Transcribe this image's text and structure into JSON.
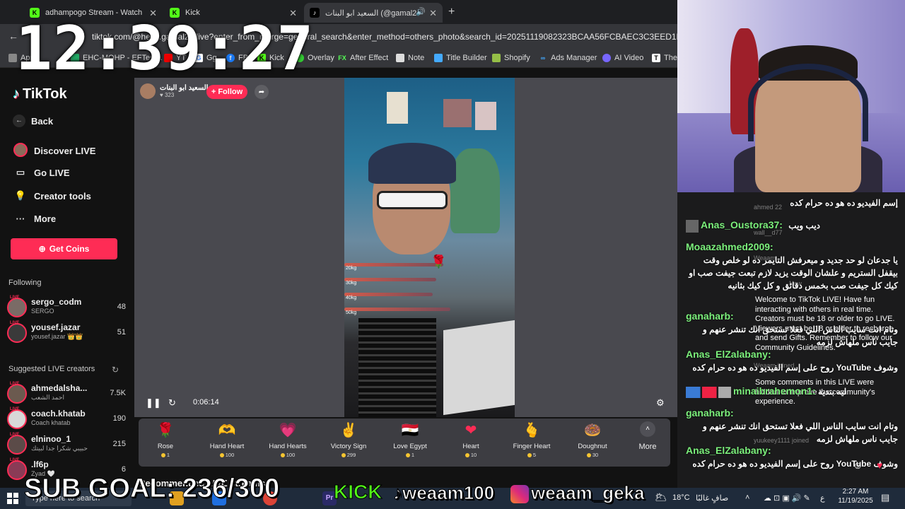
{
  "browser": {
    "tabs": [
      {
        "title": "adhampogo Stream - Watch Liv",
        "icon": "kick-icon",
        "active": false
      },
      {
        "title": "Kick",
        "icon": "kick-icon",
        "active": false
      },
      {
        "title": "السعيد ابو البنات (@gamal24",
        "icon": "tiktok-icon",
        "active": true
      }
    ],
    "url": "tiktok.com/@helio.gamal24/live?enter_from_merge=general_search&enter_method=others_photo&search_id=20251119082323BCAA56FCBAEC3C3EED1E&search",
    "bookmarks": [
      "Apps",
      "EHC-MOHP - EFTest...",
      "YT",
      "Gg",
      "FB",
      "Kick",
      "Overlay",
      "After Effect",
      "Note",
      "Title Builder",
      "Shopify",
      "Ads Manager",
      "AI Video",
      "The"
    ]
  },
  "tiktok": {
    "logo": "TikTok",
    "nav": [
      {
        "label": "Back",
        "icon": "arrow-left-icon"
      },
      {
        "label": "Discover LIVE",
        "icon": "avatar-icon"
      },
      {
        "label": "Go LIVE",
        "icon": "camera-icon"
      },
      {
        "label": "Creator tools",
        "icon": "lightbulb-icon"
      },
      {
        "label": "More",
        "icon": "ellipsis-icon"
      }
    ],
    "get_coins": "Get Coins",
    "following_title": "Following",
    "following": [
      {
        "name": "sergo_codm",
        "sub": "SERGO",
        "count": "48"
      },
      {
        "name": "yousef.jazar",
        "sub": "yousef.jazar 👑👑",
        "count": "51"
      }
    ],
    "suggested_title": "Suggested LIVE creators",
    "suggested": [
      {
        "name": "ahmedalsha...",
        "sub": "احمد الشعب",
        "count": "7.5K"
      },
      {
        "name": "coach.khatab",
        "sub": "Coach khatab",
        "count": "190"
      },
      {
        "name": "elninoo_1",
        "sub": "حبيبي شكرا جدا لبيتك",
        "count": "215"
      },
      {
        "name": ".lf6p",
        "sub": "Zyad 🤍",
        "count": "6"
      }
    ],
    "host": {
      "name": "السعيد ابو البنات",
      "viewers": "323"
    },
    "follow_label": "+ Follow",
    "video_time": "0:06:14",
    "gift_scale": [
      "20kg",
      "30kg",
      "40kg",
      "50kg"
    ],
    "gifts": [
      {
        "name": "Rose",
        "price": "1",
        "icon": "🌹"
      },
      {
        "name": "Hand Heart",
        "price": "100",
        "icon": "🫶"
      },
      {
        "name": "Hand Hearts",
        "price": "100",
        "icon": "💗"
      },
      {
        "name": "Victory Sign",
        "price": "299",
        "icon": "✌"
      },
      {
        "name": "Love Egypt",
        "price": "1",
        "icon": "🇪🇬"
      },
      {
        "name": "Heart",
        "price": "10",
        "icon": "❤"
      },
      {
        "name": "Finger Heart",
        "price": "5",
        "icon": "🫰"
      },
      {
        "name": "Doughnut",
        "price": "30",
        "icon": "🍩"
      }
    ],
    "more_label": "More",
    "recommended": "Recommended LIVE streams"
  },
  "chat": {
    "tiktok_notices": [
      "Welcome to TikTok LIVE! Have fun interacting with others in real time. Creators must be 18 or older to go LIVE. Viewers must be 18 or older to recharge and send Gifts. Remember to follow our Community Guidelines.",
      "Some comments in this LIVE were hidden to improve the community's experience."
    ],
    "tiktok_bg": [
      "ahmed 22",
      "wall__d77",
      "Weaam",
      "New",
      "Weaam joined",
      "yuukeey1111 joined"
    ],
    "messages": [
      {
        "user": "",
        "text": "إسم الفيديو ده هو ده حرام كده"
      },
      {
        "user": "Anas_Oustora37:",
        "text": "ديب ويب"
      },
      {
        "user": "Moaazahmed2009:",
        "text": "يا جدعان لو حد جديد و ميعرفش التايمر ده لو خلص وقت بيقفل الستريم و علشان الوقت يزيد لازم تبعت جيفت صب او كيك كل جيفت صب بخمس دقائق و كل كيك بثانيه"
      },
      {
        "user": "ganaharb:",
        "text": "وتام انت سايب الناس اللي فعلا تستحق انك تنشر عنهم و جايب ناس ملهاش لزمه"
      },
      {
        "user": "Anas_ElZalabany:",
        "text": "وشوف YouTube روح على إسم الفيديو ده هو ده حرام كده"
      },
      {
        "user": "minaibrahemon1:",
        "text": "ليه بتديه"
      },
      {
        "user": "ganaharb:",
        "text": "وتام انت سايب الناس اللي فعلا تستحق انك تنشر عنهم و جايب ناس ملهاش لزمه"
      },
      {
        "user": "Anas_ElZalabany:",
        "text": "وشوف YouTube روح على إسم الفيديو ده هو ده حرام كده"
      }
    ]
  },
  "overlay": {
    "clock": "12:39:27",
    "sub_goal": "SUB GOAL: 236/300",
    "kick_name": "weaam100",
    "instagram": "weaam_geka"
  },
  "taskbar": {
    "search_placeholder": "Type here to search",
    "weather_temp": "18°C",
    "weather_text": "صافٍ غالبًا",
    "lang": "ع",
    "time": "2:27 AM",
    "date": "11/19/2025"
  },
  "colors": {
    "tiktok_pink": "#fe2c55",
    "kick_green": "#53fc18",
    "chat_user_green": "#7cf07c"
  }
}
